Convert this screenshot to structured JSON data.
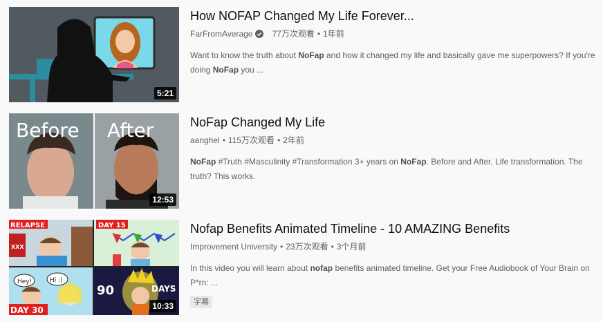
{
  "results": [
    {
      "title": "How NOFAP Changed My Life Forever...",
      "channel": "FarFromAverage",
      "verified": true,
      "views": "77万次观看",
      "age": "1年前",
      "duration": "5:21",
      "description": [
        {
          "t": "Want to know the truth about "
        },
        {
          "t": "NoFap",
          "b": true
        },
        {
          "t": " and how it changed my life and basically gave me superpowers? If you're doing "
        },
        {
          "t": "NoFap",
          "b": true
        },
        {
          "t": " you ..."
        }
      ]
    },
    {
      "title": "NoFap Changed My Life",
      "channel": "aanghel",
      "verified": false,
      "views": "115万次观看",
      "age": "2年前",
      "duration": "12:53",
      "thumb_text_left": "Before",
      "thumb_text_right": "After",
      "description": [
        {
          "t": "NoFap",
          "b": true
        },
        {
          "t": " #Truth #Masculinity #Transformation 3+ years on "
        },
        {
          "t": "NoFap",
          "b": true
        },
        {
          "t": ". Before and After. Life transformation. The truth? This works."
        }
      ]
    },
    {
      "title": "Nofap Benefits Animated Timeline - 10 AMAZING Benefits",
      "channel": "Improvement University",
      "verified": false,
      "views": "23万次观看",
      "age": "3个月前",
      "duration": "10:33",
      "badge": "字幕",
      "thumb_labels": {
        "relapse": "RELAPSE",
        "day15": "DAY 15",
        "hey": "Hey!",
        "hi": "Hi :)",
        "day30": "DAY 30",
        "ninety": "90",
        "days": "DAYS",
        "xxx": "XXX"
      },
      "description": [
        {
          "t": "In this video you will learn about "
        },
        {
          "t": "nofap",
          "b": true
        },
        {
          "t": " benefits animated timeline. Get your Free Audiobook of Your Brain on P*rn: ..."
        }
      ]
    }
  ],
  "separator": "•",
  "colors": {
    "title": "#0f0f0f",
    "meta": "#606060",
    "page_bg": "#f9f9f9"
  }
}
